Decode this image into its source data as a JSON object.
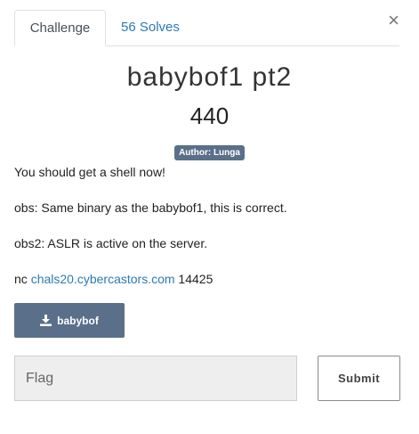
{
  "modal": {
    "close_symbol": "×",
    "tabs": [
      {
        "label": "Challenge",
        "active": true
      },
      {
        "label": "56 Solves",
        "active": false
      }
    ],
    "title": "babybof1 pt2",
    "points": "440",
    "author_badge": "Author: Lunga",
    "description": {
      "line1": "You should get a shell now!",
      "line2": "obs: Same binary as the babybof1, this is correct.",
      "line3": "obs2: ASLR is active on the server.",
      "nc_prefix": "nc",
      "nc_host": "chals20.cybercastors.com",
      "nc_port": "14425"
    },
    "download": {
      "label": "babybof",
      "icon": "download-icon"
    },
    "flag_input": {
      "placeholder": "Flag",
      "value": ""
    },
    "submit_label": "Submit"
  },
  "colors": {
    "accent": "#5a6f89",
    "link": "#2d7ab7",
    "input_bg": "#eeeeee"
  }
}
